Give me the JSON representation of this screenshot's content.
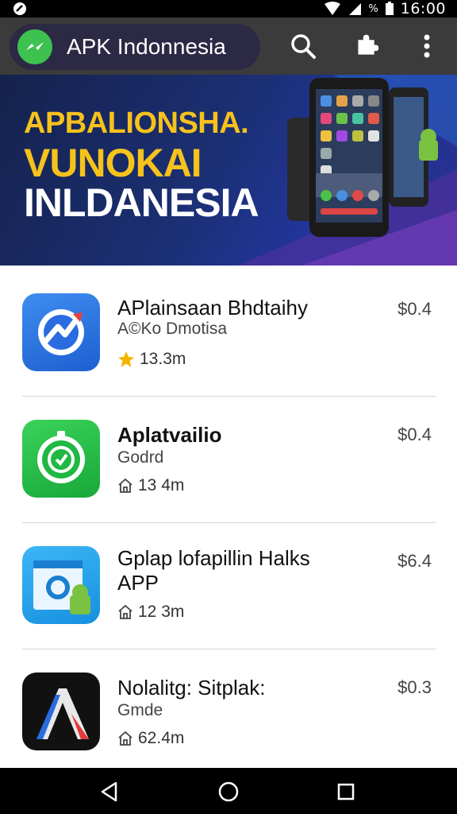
{
  "status_bar": {
    "battery_pct": "%",
    "time": "16:00"
  },
  "header": {
    "title": "APK Indonnesia"
  },
  "icons": {
    "search": "search-icon",
    "puzzle": "puzzle-icon",
    "menu": "more-vert-icon"
  },
  "banner": {
    "line1": "APBALIONSHA.",
    "line2": "VUNOKAI",
    "line3": "INLDANESIA"
  },
  "apps": [
    {
      "title": "APlainsaan Bhdtaihy",
      "subtitle": "A©Ko Dmotisa",
      "meta": "13.3m",
      "meta_icon": "star-icon",
      "price": "$0.4",
      "icon": "blue-arrow-app-icon"
    },
    {
      "title": "Aplatvailio",
      "subtitle": "Godrd",
      "meta": "13 4m",
      "meta_icon": "download-icon",
      "price": "$0.4",
      "icon": "green-clock-app-icon"
    },
    {
      "title": "Gplap lofapillin Halks",
      "title_line2": "APP",
      "subtitle": "",
      "meta": "12 3m",
      "meta_icon": "download-icon",
      "price": "$6.4",
      "icon": "android-browser-app-icon"
    },
    {
      "title": "Nolalitg: Sitplak:",
      "subtitle": "Gmde",
      "meta": "62.4m",
      "meta_icon": "download-icon",
      "price": "$0.3",
      "icon": "letter-a-app-icon"
    }
  ],
  "colors": {
    "accent_green": "#3ec24f",
    "app_bar": "#3b3b3b",
    "banner_yellow": "#f6c21c"
  }
}
